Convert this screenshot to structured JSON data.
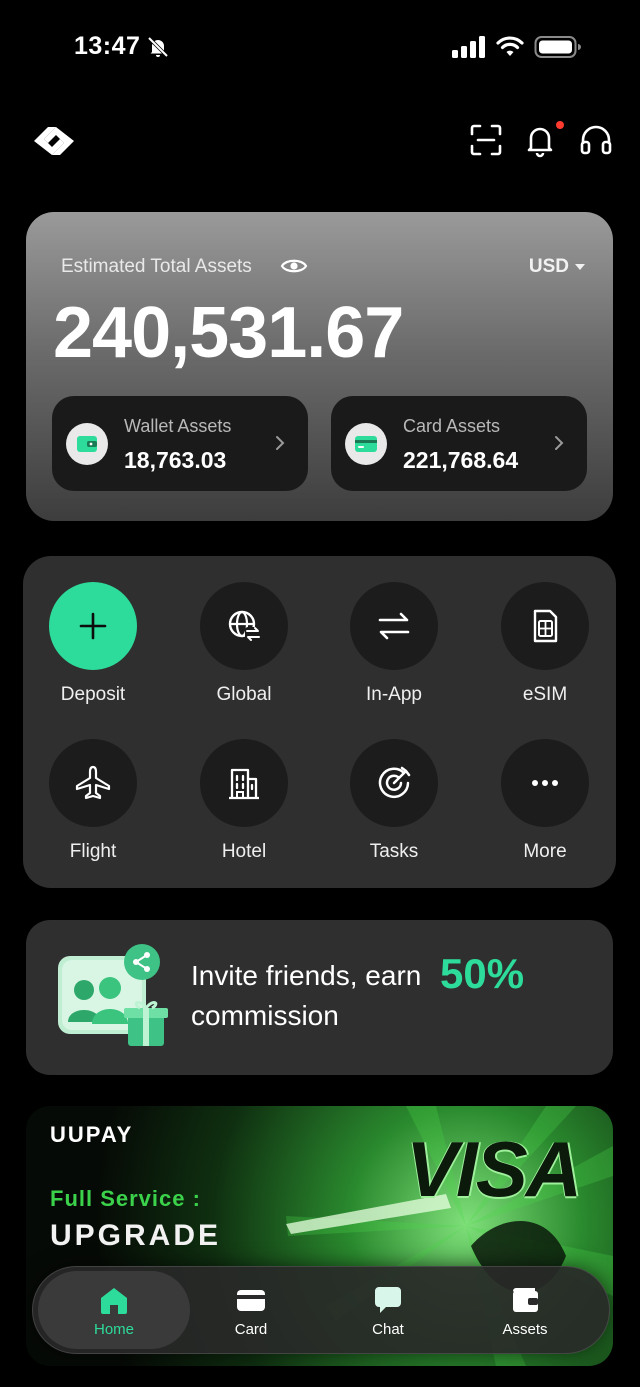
{
  "status_bar": {
    "time": "13:47",
    "icons": [
      "bell-off-icon",
      "signal-icon",
      "wifi-icon",
      "battery-icon"
    ]
  },
  "header": {
    "icons": [
      "logo-icon",
      "scan-icon",
      "notification-bell-icon",
      "headset-icon"
    ],
    "has_notification": true
  },
  "assets": {
    "label": "Estimated Total Assets",
    "currency": "USD",
    "total": "240,531.67",
    "wallet": {
      "label": "Wallet Assets",
      "value": "18,763.03"
    },
    "card": {
      "label": "Card Assets",
      "value": "221,768.64"
    }
  },
  "services": [
    {
      "label": "Deposit",
      "icon": "plus-icon"
    },
    {
      "label": "Global",
      "icon": "globe-transfer-icon"
    },
    {
      "label": "In-App",
      "icon": "swap-arrows-icon"
    },
    {
      "label": "eSIM",
      "icon": "sim-card-icon"
    },
    {
      "label": "Flight",
      "icon": "airplane-icon"
    },
    {
      "label": "Hotel",
      "icon": "building-icon"
    },
    {
      "label": "Tasks",
      "icon": "target-icon"
    },
    {
      "label": "More",
      "icon": "more-dots-icon"
    }
  ],
  "invite": {
    "text_line1": "Invite friends, earn",
    "percent": "50%",
    "text_line2": "commission"
  },
  "promo": {
    "brand": "UUPAY",
    "kicker": "Full Service :",
    "title": "UPGRADE",
    "card_network": "VISA"
  },
  "tabbar": {
    "tabs": [
      {
        "label": "Home",
        "icon": "home-icon",
        "active": true
      },
      {
        "label": "Card",
        "icon": "card-icon",
        "active": false
      },
      {
        "label": "Chat",
        "icon": "chat-icon",
        "active": false
      },
      {
        "label": "Assets",
        "icon": "wallet-icon",
        "active": false
      }
    ]
  },
  "colors": {
    "accent": "#2ddb9a",
    "notification_dot": "#ff3b30",
    "promo_green": "#3bd14a"
  }
}
